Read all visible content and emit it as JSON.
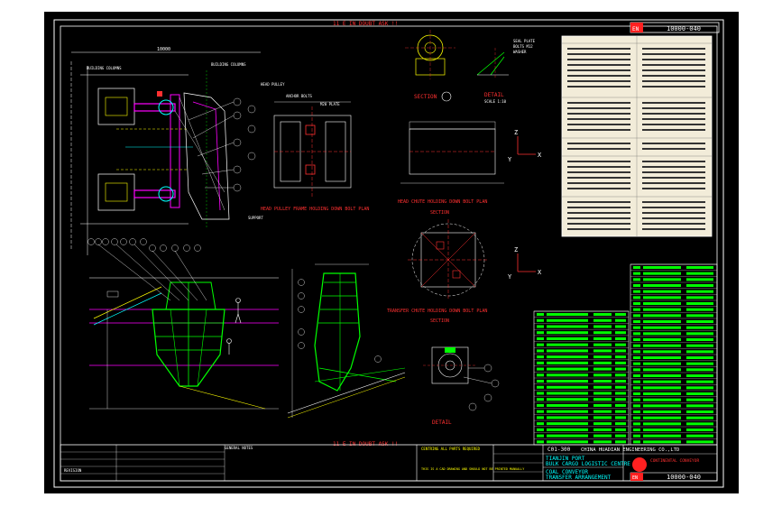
{
  "drawing": {
    "number_top": "10000-040",
    "number_bottom": "10000-040",
    "sheet_marker": "EN",
    "grid_label_top": "11 E IN DOUBT ASK !!",
    "grid_label_bottom": "11 E IN DOUBT ASK !!",
    "dim_top": "10000",
    "view_labels": {
      "head_pulley_plan": "HEAD PULLEY FRAME HOLDING DOWN BOLT PLAN",
      "head_chute_plan": "HEAD CHUTE HOLDING DOWN BOLT PLAN",
      "transfer_chute_plan": "TRANSFER CHUTE HOLDING DOWN BOLT PLAN",
      "section_a": "SECTION",
      "section_b": "SECTION",
      "section_c": "SECTION",
      "detail_a": "DETAIL",
      "detail_b": "DETAIL",
      "scale_note": "SCALE 1:10"
    },
    "axis_labels": {
      "z": "Z",
      "x": "X",
      "y": "Y"
    }
  },
  "title_block": {
    "company": "CHINA HUADIAN ENGINEERING CO.,LTD",
    "client_line1": "TIANJIN PORT",
    "client_line2": "BULK CARGO LOGISTIC CENTRE",
    "title_line1": "COAL CONVEYOR",
    "title_line2": "TRANSFER ARRANGEMENT",
    "contractor": "CONTINENTAL CONVEYOR",
    "project_code": "C01-300",
    "notes_header": "GENERAL NOTES",
    "note1": "CENTRING ALL PARTS REQUIRED",
    "note2": "THIS IS A CAD DRAWING AND SHOULD NOT BE PRINTED MANUALLY",
    "rev_header": "REVISION"
  },
  "colors": {
    "background": "#000000",
    "frame": "#ffffff",
    "cyan": "#00ffff",
    "green": "#00ff00",
    "magenta": "#ff00ff",
    "red": "#ff2020",
    "yellow": "#ffff00",
    "table_bg": "#f2ecd9"
  }
}
